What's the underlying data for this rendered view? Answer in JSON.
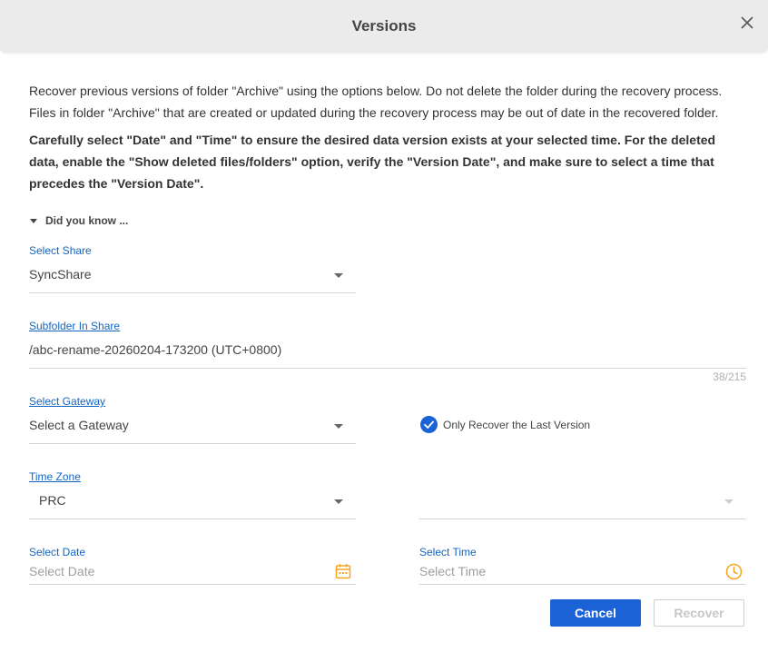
{
  "dialog": {
    "title": "Versions"
  },
  "description": {
    "line1": "Recover previous versions of folder \"Archive\" using the options below. Do not delete the folder during the recovery process. Files in folder \"Archive\" that are created or updated during the recovery process may be out of date in the recovered folder.",
    "warning": "Carefully select \"Date\" and \"Time\" to ensure the desired data version exists at your selected time. For the deleted data, enable the \"Show deleted files/folders\" option, verify the \"Version Date\", and make sure to select a time that precedes the \"Version Date\"."
  },
  "did_you_know": {
    "label": "Did you know ..."
  },
  "share": {
    "label": "Select Share",
    "value": "SyncShare"
  },
  "subfolder": {
    "label": "Subfolder In Share",
    "value": "/abc-rename-20260204-173200 (UTC+0800)",
    "counter": "38/215"
  },
  "gateway": {
    "label": "Select Gateway",
    "placeholder": "Select a Gateway"
  },
  "only_last_version": {
    "label": "Only Recover the Last Version",
    "checked": true
  },
  "timezone": {
    "label": "Time Zone",
    "value": "PRC"
  },
  "date": {
    "label": "Select Date",
    "placeholder": "Select Date",
    "icon": "calendar-icon"
  },
  "time": {
    "label": "Select Time",
    "placeholder": "Select Time",
    "icon": "clock-icon"
  },
  "buttons": {
    "cancel": "Cancel",
    "recover": "Recover"
  },
  "colors": {
    "accent": "#1a62d6",
    "label_blue": "#1565c0",
    "icon_orange": "#f5a623"
  }
}
